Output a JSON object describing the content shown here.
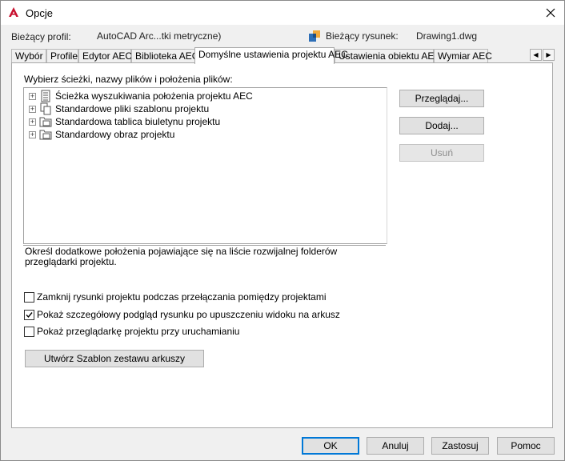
{
  "window": {
    "title": "Opcje"
  },
  "profile": {
    "current_profile_label": "Bieżący profil:",
    "current_profile_value": "AutoCAD Arc...tki metryczne)",
    "current_drawing_label": "Bieżący rysunek:",
    "current_drawing_value": "Drawing1.dwg"
  },
  "tabs": [
    {
      "label": "Wybór"
    },
    {
      "label": "Profile"
    },
    {
      "label": "Edytor AEC"
    },
    {
      "label": "Biblioteka AEC"
    },
    {
      "label": "Domyślne ustawienia projektu AEC",
      "active": true
    },
    {
      "label": "Ustawienia obiektu AEC"
    },
    {
      "label": "Wymiar AEC"
    }
  ],
  "panel": {
    "paths_label": "Wybierz ścieżki, nazwy plików i położenia plików:",
    "tree_items": [
      {
        "label": "Ścieżka wyszukiwania położenia projektu AEC",
        "icon": "search-path-icon",
        "expander": "+"
      },
      {
        "label": "Standardowe pliki szablonu projektu",
        "icon": "template-files-icon",
        "expander": "+"
      },
      {
        "label": "Standardowa tablica biuletynu projektu",
        "icon": "bulletin-board-icon",
        "expander": "+"
      },
      {
        "label": "Standardowy obraz projektu",
        "icon": "project-image-icon",
        "expander": "+"
      }
    ],
    "description": "Określ dodatkowe położenia pojawiające się na liście rozwijalnej folderów przeglądarki projektu.",
    "browse_button": "Przeglądaj...",
    "add_button": "Dodaj...",
    "remove_button": "Usuń",
    "checkboxes": [
      {
        "label": "Zamknij rysunki projektu podczas przełączania pomiędzy projektami",
        "checked": false
      },
      {
        "label": "Pokaż szczegółowy podgląd rysunku po upuszczeniu widoku na arkusz",
        "checked": true
      },
      {
        "label": "Pokaż przeglądarkę projektu przy uruchamianiu",
        "checked": false
      }
    ],
    "create_template_button": "Utwórz Szablon zestawu arkuszy"
  },
  "footer": {
    "ok": "OK",
    "cancel": "Anuluj",
    "apply": "Zastosuj",
    "help": "Pomoc"
  },
  "colors": {
    "accent": "#0078d7",
    "app_icon_red": "#c8102e",
    "window_bg": "#f0f0f0",
    "panel_bg": "#ffffff"
  }
}
